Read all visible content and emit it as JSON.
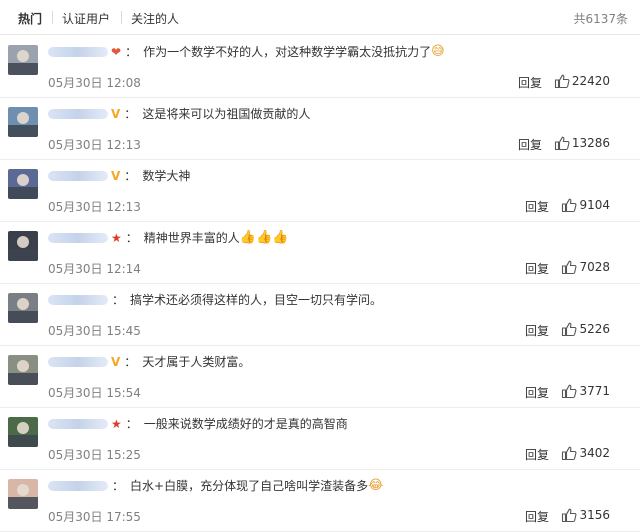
{
  "tabs": [
    "热门",
    "认证用户",
    "关注的人"
  ],
  "total": "共6137条",
  "reply_label": "回复",
  "comments": [
    {
      "badge": "heart",
      "text": "作为一个数学不好的人，对这种数学学霸太没抵抗力了",
      "emoji": "😅",
      "time": "05月30日 12:08",
      "likes": "22420",
      "avatar_color": "#9aa3ad"
    },
    {
      "badge": "v",
      "text": "这是将来可以为祖国做贡献的人",
      "emoji": "",
      "time": "05月30日 12:13",
      "likes": "13286",
      "avatar_color": "#6f8fb0"
    },
    {
      "badge": "v",
      "text": "数学大神",
      "emoji": "",
      "time": "05月30日 12:13",
      "likes": "9104",
      "avatar_color": "#5a6a94"
    },
    {
      "badge": "star",
      "text": "精神世界丰富的人",
      "emoji": "👍👍👍",
      "time": "05月30日 12:14",
      "likes": "7028",
      "avatar_color": "#3a3f4a"
    },
    {
      "badge": "",
      "text": "搞学术还必须得这样的人，目空一切只有学问。",
      "emoji": "",
      "time": "05月30日 15:45",
      "likes": "5226",
      "avatar_color": "#7a7f86"
    },
    {
      "badge": "v",
      "text": "天才属于人类财富。",
      "emoji": "",
      "time": "05月30日 15:54",
      "likes": "3771",
      "avatar_color": "#8a8f84"
    },
    {
      "badge": "star",
      "text": "一般来说数学成绩好的才是真的高智商",
      "emoji": "",
      "time": "05月30日 15:25",
      "likes": "3402",
      "avatar_color": "#4d6a48"
    },
    {
      "badge": "",
      "text": "白水+白膜，充分体现了自己啥叫学渣装备多",
      "emoji": "😂",
      "time": "05月30日 17:55",
      "likes": "3156",
      "avatar_color": "#d9b7a8"
    }
  ]
}
